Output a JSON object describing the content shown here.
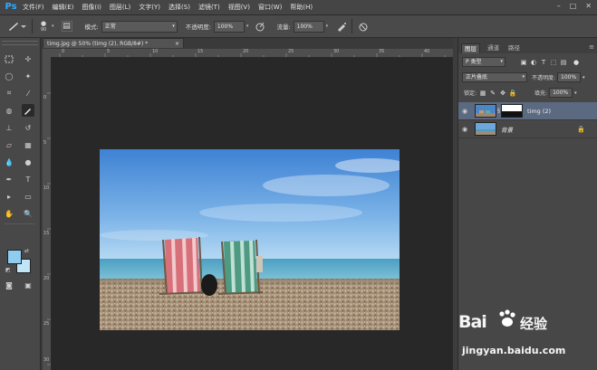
{
  "app": {
    "logo": "Ps"
  },
  "menubar": {
    "items": [
      "文件(F)",
      "编辑(E)",
      "图像(I)",
      "图层(L)",
      "文字(Y)",
      "选择(S)",
      "滤镜(T)",
      "视图(V)",
      "窗口(W)",
      "帮助(H)"
    ],
    "window_controls": [
      "–",
      "□",
      "✕"
    ]
  },
  "options": {
    "brush_size": "90",
    "mode_label": "模式:",
    "mode_value": "正常",
    "opacity_label": "不透明度:",
    "opacity_value": "100%",
    "flow_label": "流量:",
    "flow_value": "100%"
  },
  "document": {
    "tab_title": "timg.jpg @ 50% (timg (2), RGB/8#) *",
    "close": "×",
    "ruler_top": [
      "0",
      "5",
      "10",
      "15",
      "20",
      "25",
      "30",
      "35",
      "40"
    ],
    "ruler_left": [
      "0",
      "5",
      "10",
      "15",
      "20",
      "25",
      "30"
    ]
  },
  "panel": {
    "tabs": [
      "图层",
      "通道",
      "路径"
    ],
    "kind_filter": "P 类型",
    "blend_mode": "正片叠底",
    "opacity_label": "不透明度:",
    "opacity_value": "100%",
    "lock_label": "锁定:",
    "fill_label": "填充:",
    "fill_value": "100%",
    "layers": [
      {
        "name": "timg (2)",
        "selected": true
      },
      {
        "name": "背景",
        "selected": false
      }
    ]
  },
  "watermark": {
    "brand": "Bai",
    "brand_suffix": "经验",
    "url": "jingyan.baidu.com"
  },
  "colors": {
    "foreground": "#8ecdf0",
    "background": "#bfe5f7",
    "selected_layer": "#5b6a80",
    "ps_accent": "#31a8ff"
  }
}
